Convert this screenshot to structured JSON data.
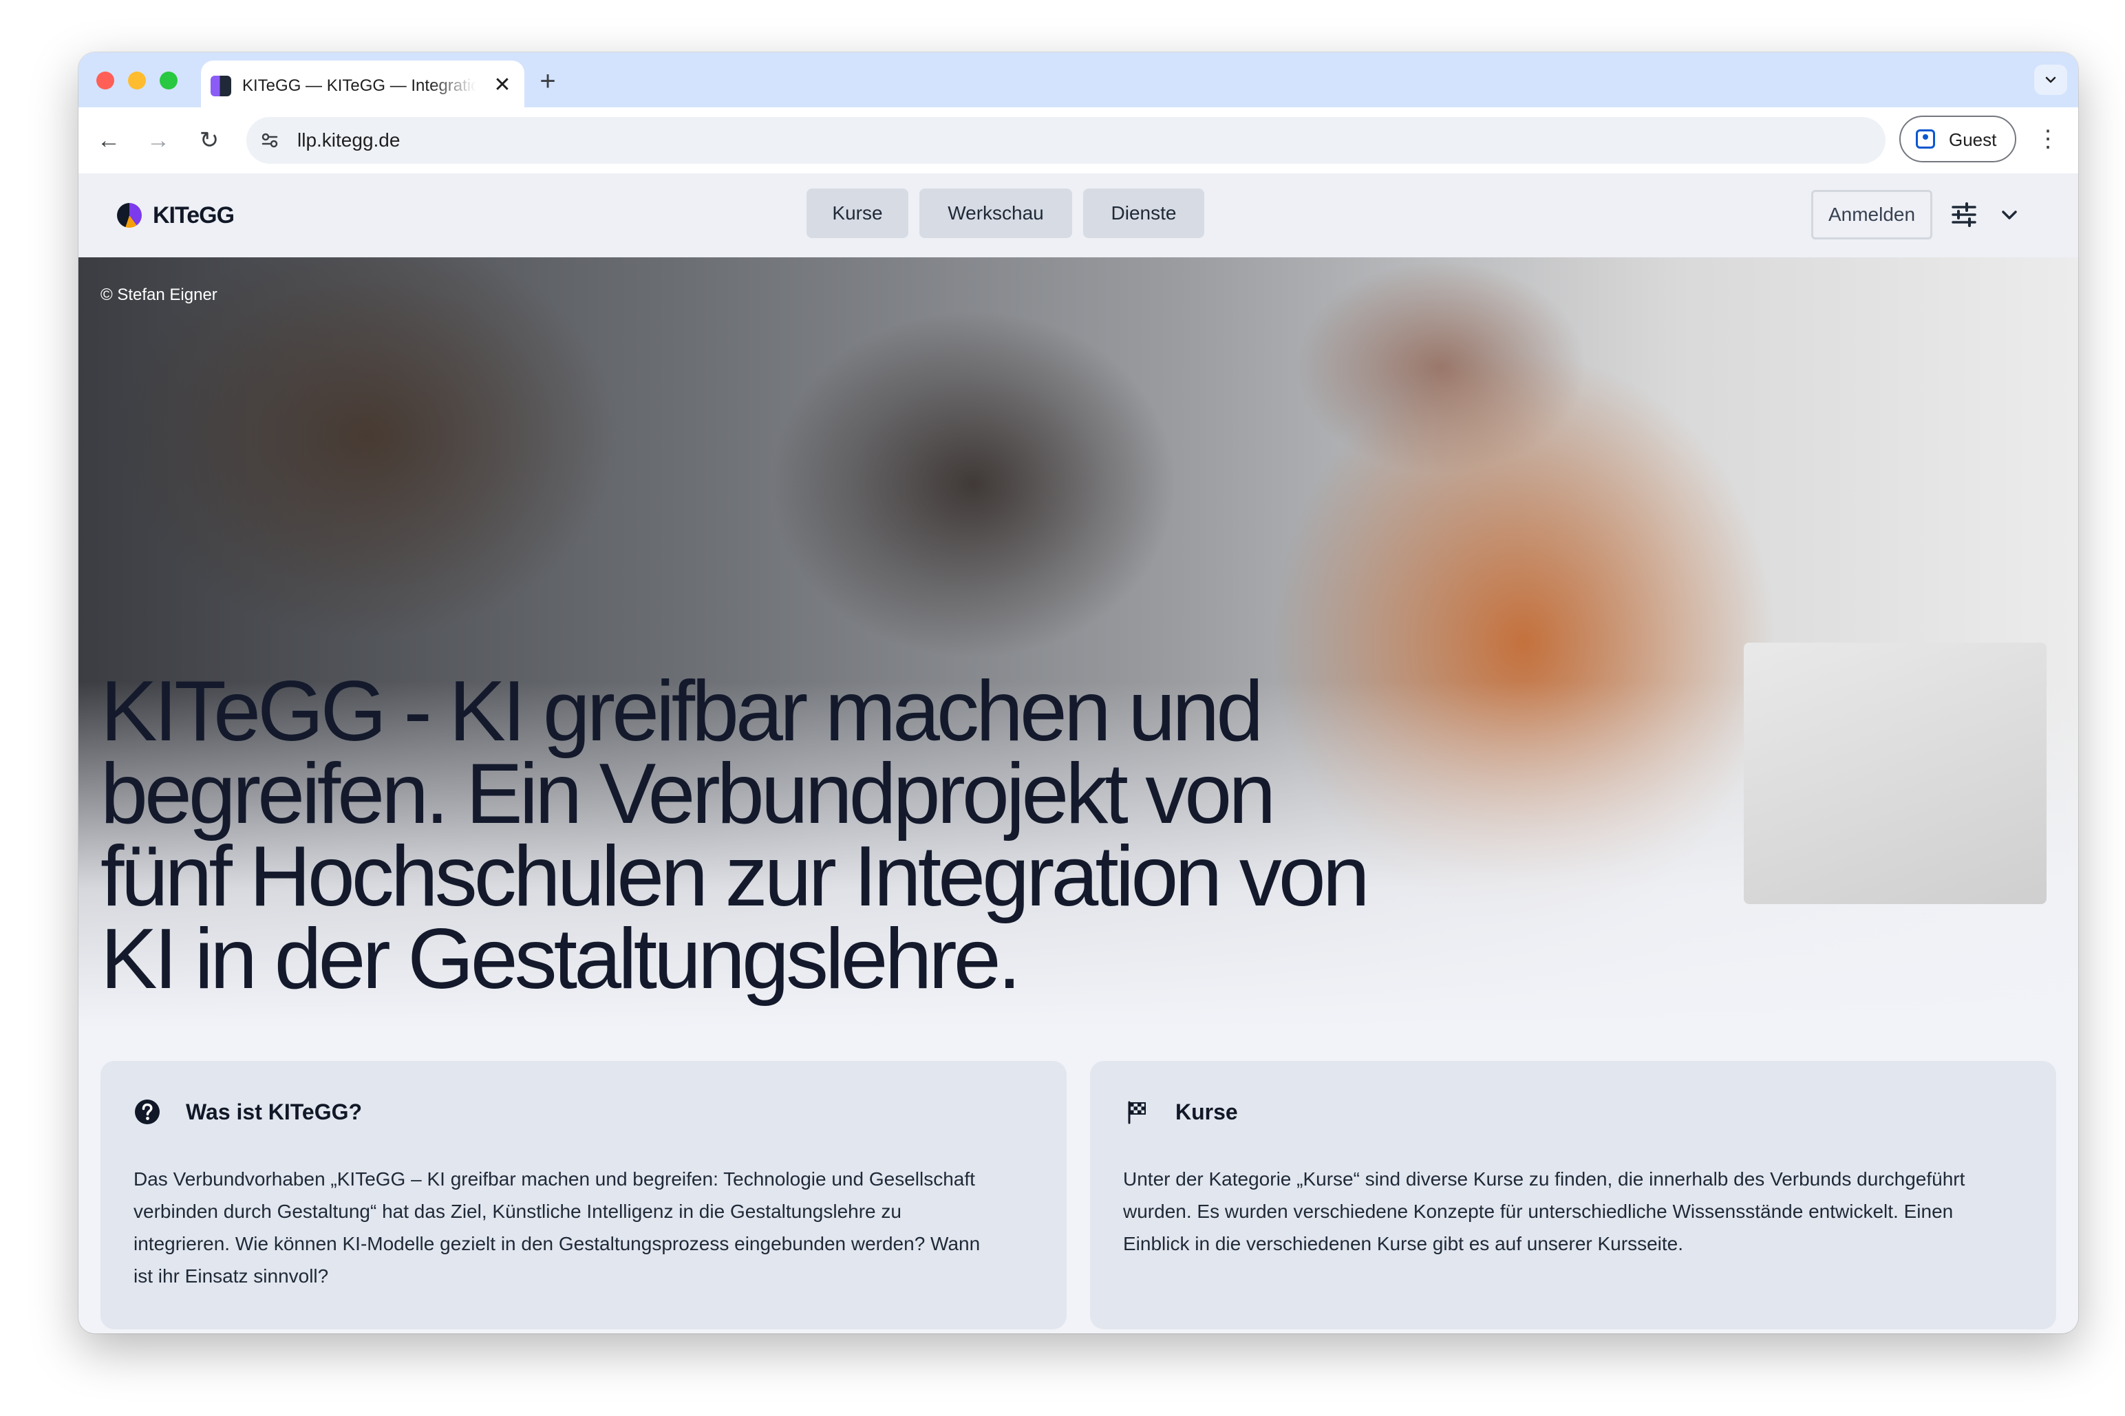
{
  "browser": {
    "tab_title": "KITeGG — KITeGG — Integration von KI in der Gestaltungslehre",
    "tab_close": "✕",
    "new_tab": "+",
    "tab_menu": "⌄",
    "url": "llp.kitegg.de",
    "profile_label": "Guest",
    "back": "←",
    "forward": "→",
    "reload": "↻",
    "menu": "⋮",
    "site_info": "⚲"
  },
  "site": {
    "logo": "KITeGG",
    "nav": [
      "Kurse",
      "Werkschau",
      "Dienste"
    ],
    "login": "Anmelden"
  },
  "hero": {
    "credit": "© Stefan Eigner",
    "title": "KITeGG - KI greifbar machen und begreifen. Ein Verbundprojekt von fünf Hochschulen zur Integration von KI in der Gestaltungslehre."
  },
  "cards": [
    {
      "icon": "question-circle-icon",
      "title": "Was ist KITeGG?",
      "body": "Das Verbundvorhaben „KITeGG – KI greifbar machen und begreifen: Technologie und Gesellschaft verbinden durch Gestaltung“ hat das Ziel, Künstliche Intelligenz in die Gestaltungslehre zu integrieren. Wie können KI-Modelle gezielt in den Gestaltungsprozess eingebunden werden? Wann ist ihr Einsatz sinnvoll?"
    },
    {
      "icon": "checkered-flag-icon",
      "title": "Kurse",
      "body": "Unter der Kategorie „Kurse“ sind diverse Kurse zu finden, die innerhalb des Verbunds durchgeführt wurden. Es wurden verschiedene Konzepte für unterschiedliche Wissensstände entwickelt. Einen Einblick in die verschiedenen Kurse gibt es auf unserer Kursseite."
    }
  ]
}
